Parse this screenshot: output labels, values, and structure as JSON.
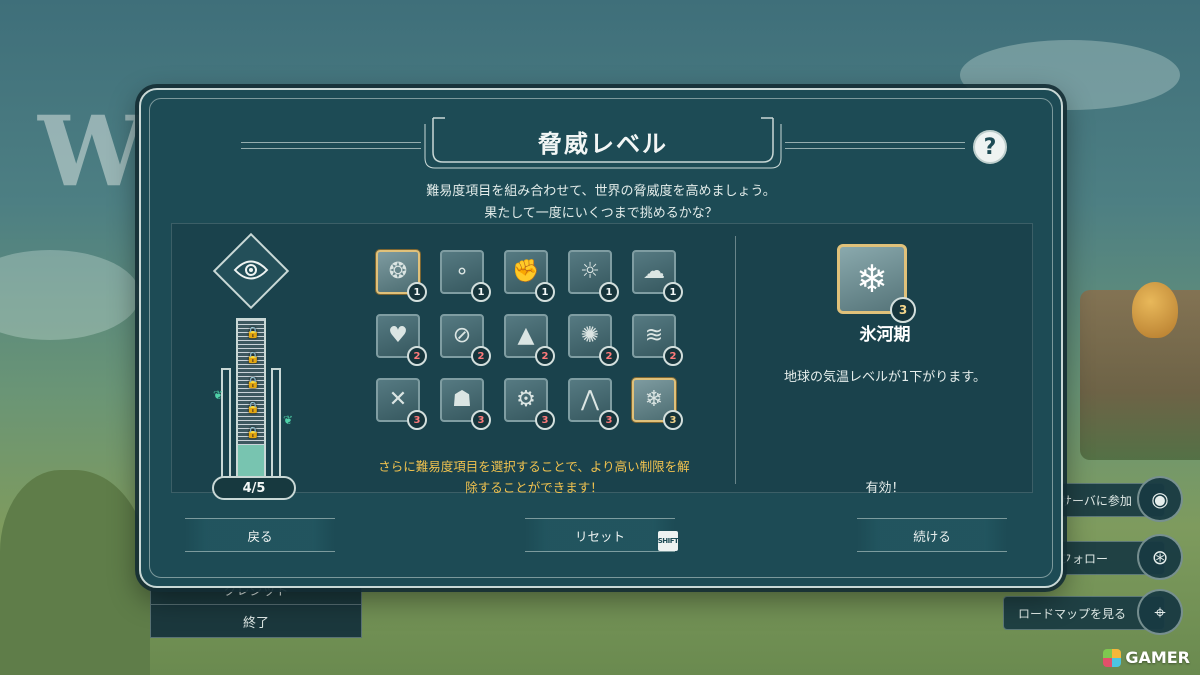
{
  "background": {
    "logo_text": "WA",
    "left_menu": {
      "credits_label": "クレジット",
      "quit_label": "終了"
    },
    "right_menu": {
      "discord_label": "サーバに参加",
      "steam_label": "フォロー",
      "roadmap_label": "ロードマップを見る"
    }
  },
  "modal": {
    "title": "脅威レベル",
    "help_label": "?",
    "subtitle_line1": "難易度項目を組み合わせて、世界の脅威度を高めましょう。",
    "subtitle_line2": "果たして一度にいくつまで挑めるかな？",
    "tower": {
      "count_label": "4/5",
      "progress": 0.8,
      "locks": 5
    },
    "modifiers": [
      {
        "name": "wind-spirit-icon",
        "glyph": "❂",
        "level": "1",
        "selected": true
      },
      {
        "name": "bubbles-icon",
        "glyph": "∘",
        "level": "1",
        "selected": false
      },
      {
        "name": "fist-icon",
        "glyph": "✊",
        "level": "1",
        "selected": false
      },
      {
        "name": "sunburst-icon",
        "glyph": "☼",
        "level": "1",
        "selected": false
      },
      {
        "name": "clouds-icon",
        "glyph": "☁",
        "level": "1",
        "selected": false
      },
      {
        "name": "heartbeat-icon",
        "glyph": "♥",
        "level": "2",
        "selected": false
      },
      {
        "name": "crossed-out-heart-icon",
        "glyph": "⊘",
        "level": "2",
        "selected": false
      },
      {
        "name": "pile-icon",
        "glyph": "▲",
        "level": "2",
        "selected": false
      },
      {
        "name": "radiant-bell-icon",
        "glyph": "✺",
        "level": "2",
        "selected": false
      },
      {
        "name": "swoosh-icon",
        "glyph": "≋",
        "level": "2",
        "selected": false
      },
      {
        "name": "crossed-bird-icon",
        "glyph": "✕",
        "level": "3",
        "selected": false
      },
      {
        "name": "figure-silhouette-icon",
        "glyph": "☗",
        "level": "3",
        "selected": false
      },
      {
        "name": "gear-chart-icon",
        "glyph": "⚙",
        "level": "3",
        "selected": false
      },
      {
        "name": "blades-icon",
        "glyph": "⋀",
        "level": "3",
        "selected": false
      },
      {
        "name": "snowflake-thermometer-icon",
        "glyph": "❄",
        "level": "3",
        "selected": true
      }
    ],
    "hint_line1": "さらに難易度項目を選択することで、より高い制限を解",
    "hint_line2": "除することができます！",
    "detail": {
      "glyph": "❄",
      "level": "3",
      "name": "氷河期",
      "description": "地球の気温レベルが1下がります。",
      "status": "有効！"
    },
    "footer": {
      "back_label": "戻る",
      "reset_label": "リセット",
      "reset_key": "SHIFT",
      "continue_label": "続ける"
    }
  },
  "watermark": "GAMER",
  "colors": {
    "panel": "#1d4b55",
    "accent_gold": "#e0c17a",
    "hint_text": "#f0c24f",
    "level_badge_red": "#ff7a7a"
  }
}
